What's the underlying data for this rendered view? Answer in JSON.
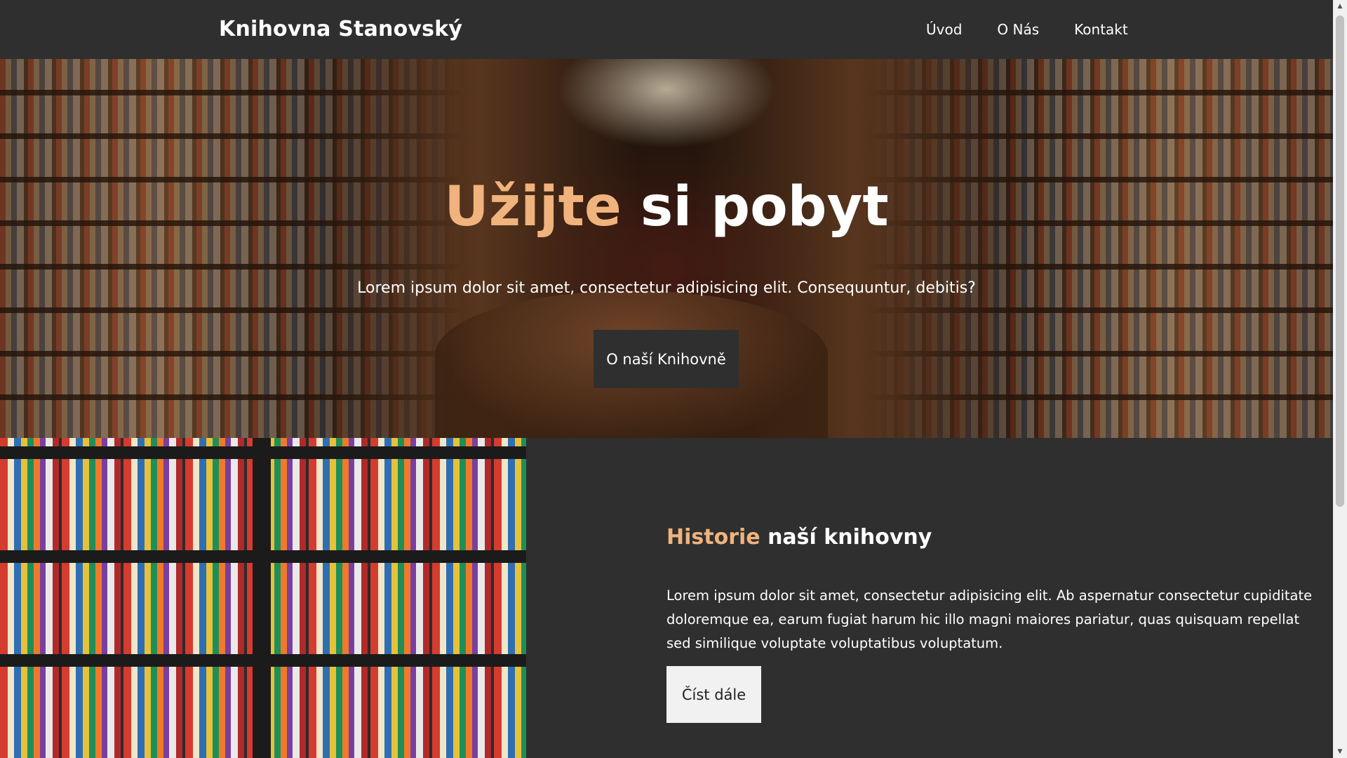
{
  "header": {
    "brand": "Knihovna Stanovský",
    "nav": [
      {
        "label": "Úvod"
      },
      {
        "label": "O Nás"
      },
      {
        "label": "Kontakt"
      }
    ]
  },
  "hero": {
    "title_accent": "Užijte",
    "title_rest": "si pobyt",
    "subtitle": "Lorem ipsum dolor sit amet, consectetur adipisicing elit. Consequuntur, debitis?",
    "button_label": "O naší Knihovně"
  },
  "history": {
    "title_accent": "Historie",
    "title_rest": "naší knihovny",
    "text": "Lorem ipsum dolor sit amet, consectetur adipisicing elit. Ab aspernatur consectetur cupiditate doloremque ea, earum fugiat harum hic illo magni maiores pariatur, quas quisquam repellat sed similique voluptate voluptatibus voluptatum.",
    "button_label": "Číst dále"
  },
  "colors": {
    "accent": "#f0b37e",
    "dark_bg": "#2f2f2f",
    "light_button": "#f1f1f1"
  },
  "icons": {
    "scroll_up": "scroll-up-arrow-icon",
    "scroll_down": "scroll-down-arrow-icon"
  }
}
